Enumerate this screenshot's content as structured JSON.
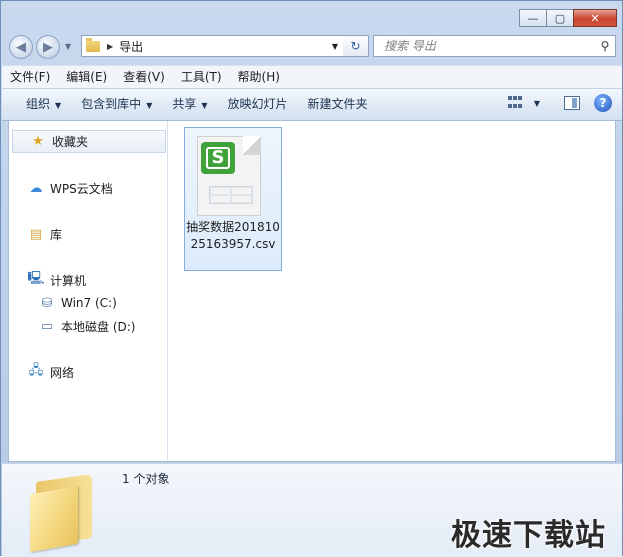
{
  "window": {
    "controls": {
      "minimize": "—",
      "maximize": "▢",
      "close": "✕"
    }
  },
  "address": {
    "path": "导出"
  },
  "search": {
    "placeholder": "搜索 导出"
  },
  "menu": [
    "文件(F)",
    "编辑(E)",
    "查看(V)",
    "工具(T)",
    "帮助(H)"
  ],
  "toolbar": {
    "organize": "组织",
    "include_library": "包含到库中",
    "share": "共享",
    "slideshow": "放映幻灯片",
    "new_folder": "新建文件夹",
    "help": "?"
  },
  "sidebar": {
    "favorites": "收藏夹",
    "wps_cloud": "WPS云文档",
    "libraries": "库",
    "computer": "计算机",
    "drive_c": "Win7 (C:)",
    "drive_d": "本地磁盘 (D:)",
    "network": "网络"
  },
  "files": [
    {
      "name": "抽奖数据20181025163957.csv",
      "icon": "wps-spreadsheet-icon"
    }
  ],
  "details": {
    "count": "1 个对象"
  },
  "watermark": "极速下载站",
  "colors": {
    "accent": "#3fa23a",
    "selection": "#dcebfb"
  }
}
